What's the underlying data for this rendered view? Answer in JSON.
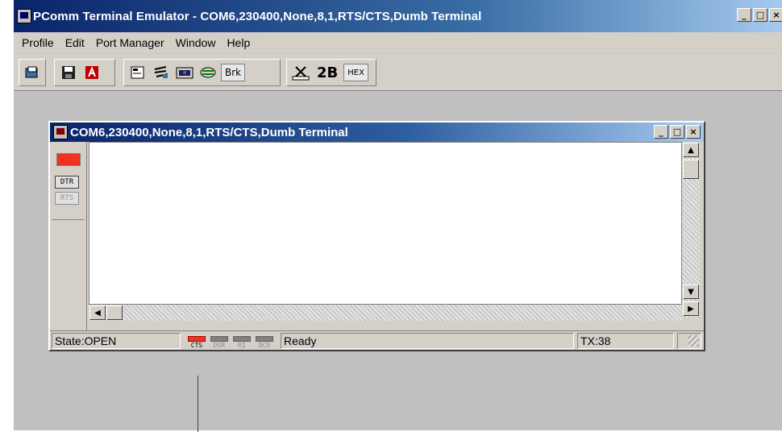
{
  "app": {
    "title": "PComm Terminal Emulator - COM6,230400,None,8,1,RTS/CTS,Dumb Terminal",
    "window_buttons": {
      "minimize": "_",
      "maximize": "□",
      "close": "×"
    }
  },
  "menu": {
    "items": [
      {
        "label": "Profile"
      },
      {
        "label": "Edit"
      },
      {
        "label": "Port Manager"
      },
      {
        "label": "Window"
      },
      {
        "label": "Help"
      }
    ]
  },
  "toolbar": {
    "buttons": [
      {
        "icon": "open-icon"
      },
      {
        "icon": "save-icon"
      },
      {
        "icon": "exit-icon"
      },
      {
        "icon": "properties-icon"
      },
      {
        "icon": "transfer-icon"
      },
      {
        "icon": "capture-icon"
      },
      {
        "icon": "macro-icon"
      },
      {
        "label": "Brk"
      },
      {
        "icon": "ruler-icon"
      },
      {
        "label": "2B"
      },
      {
        "label": "HEX"
      }
    ]
  },
  "session": {
    "title": "COM6,230400,None,8,1,RTS/CTS,Dumb Terminal",
    "signals": {
      "dtr": "DTR",
      "rts": "RTS"
    },
    "scroll_up": "▲",
    "scroll_down": "▼",
    "scroll_left": "◀",
    "scroll_right": "▶"
  },
  "status": {
    "state": "State:OPEN",
    "lamps": [
      {
        "label": "CTS",
        "on": true
      },
      {
        "label": "DSR",
        "on": false
      },
      {
        "label": "RI",
        "on": false
      },
      {
        "label": "DCD",
        "on": false
      }
    ],
    "message": "Ready",
    "tx": "TX:38"
  },
  "colors": {
    "titlebar_start": "#0a246a",
    "titlebar_end": "#a6caf0",
    "led_on": "#ee3322"
  }
}
